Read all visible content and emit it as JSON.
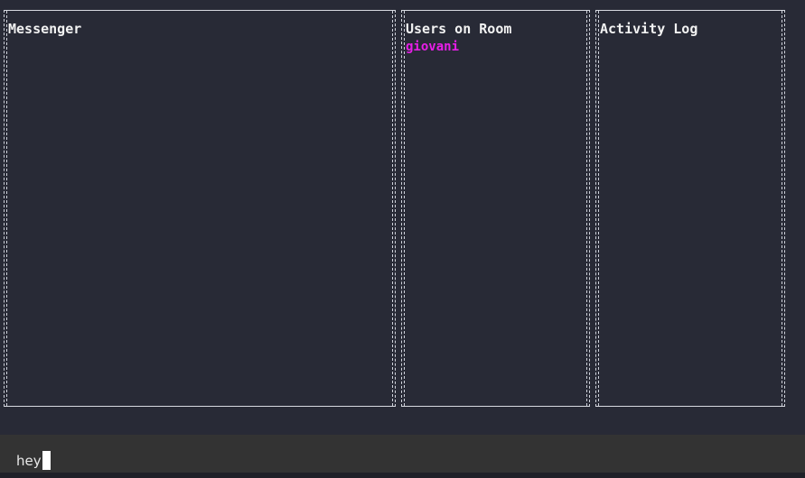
{
  "panes": {
    "messenger": {
      "title": "Messenger"
    },
    "users": {
      "title": "Users on Room",
      "items": [
        "giovani"
      ]
    },
    "activity": {
      "title": "Activity Log"
    }
  },
  "input": {
    "value": "hey"
  },
  "colors": {
    "background": "#282a36",
    "border": "#d7d9e0",
    "user_highlight": "#e81ee8",
    "input_bar": "#333333"
  }
}
